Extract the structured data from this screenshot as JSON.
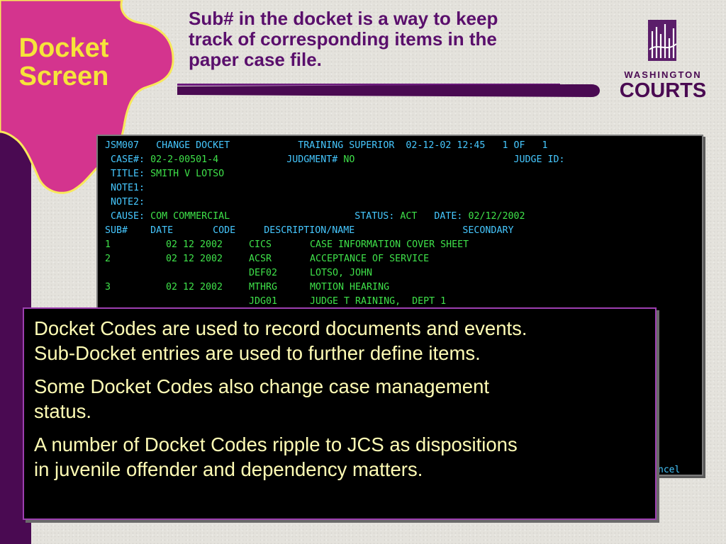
{
  "slide": {
    "title_line1": "Docket",
    "title_line2": "Screen",
    "headline_line1": "Sub# in the docket is a way to keep",
    "headline_line2": "track of corresponding items in the",
    "headline_line3": "paper case file.",
    "colors": {
      "accent": "#d4348e",
      "purple": "#4a0a52",
      "yellow": "#f6e43a"
    }
  },
  "logo": {
    "top_text": "WASHINGTON",
    "bottom_text": "COURTS",
    "icon": "courts-building-icon"
  },
  "terminal": {
    "screen_id": "JSM007",
    "screen_name": "CHANGE DOCKET",
    "env": "TRAINING SUPERIOR",
    "date": "02-12-02",
    "time": "12:45",
    "page_label": "1 OF",
    "page_total": "1",
    "case_label": "CASE#:",
    "case_value": "02-2-00501-4",
    "judgment_label": "JUDGMENT#",
    "judgment_value": "NO",
    "judge_id_label": "JUDGE ID:",
    "title_label": "TITLE:",
    "title_value": "SMITH V LOTSO",
    "note1_label": "NOTE1:",
    "note2_label": "NOTE2:",
    "cause_label": "CAUSE:",
    "cause_value": "COM COMMERCIAL",
    "status_label": "STATUS:",
    "status_value": "ACT",
    "date_label": "DATE:",
    "date_value": "02/12/2002",
    "columns": [
      "SUB#",
      "DATE",
      "CODE",
      "DESCRIPTION/NAME",
      "SECONDARY"
    ],
    "rows": [
      {
        "sub": "1",
        "date": "02 12 2002",
        "code": "CICS",
        "desc": "CASE INFORMATION COVER SHEET"
      },
      {
        "sub": "2",
        "date": "02 12 2002",
        "code": "ACSR",
        "desc": "ACCEPTANCE OF SERVICE"
      },
      {
        "sub": "",
        "date": "",
        "code": "DEF02",
        "desc": "LOTSO, JOHN"
      },
      {
        "sub": "3",
        "date": "02 12 2002",
        "code": "MTHRG",
        "desc": "MOTION HEARING"
      },
      {
        "sub": "",
        "date": "",
        "code": "JDG01",
        "desc": "JUDGE T RAINING,  DEPT 1"
      }
    ],
    "cancel_text": "ncel"
  },
  "callout": {
    "para1_line1": "Docket Codes are used to record documents and events.",
    "para1_line2": "Sub-Docket entries are used to further define items.",
    "para2_line1": "Some Docket Codes also change case management",
    "para2_line2": "status.",
    "para3_line1": "A number of Docket Codes ripple to JCS as dispositions",
    "para3_line2": "in juvenile offender and dependency matters."
  }
}
